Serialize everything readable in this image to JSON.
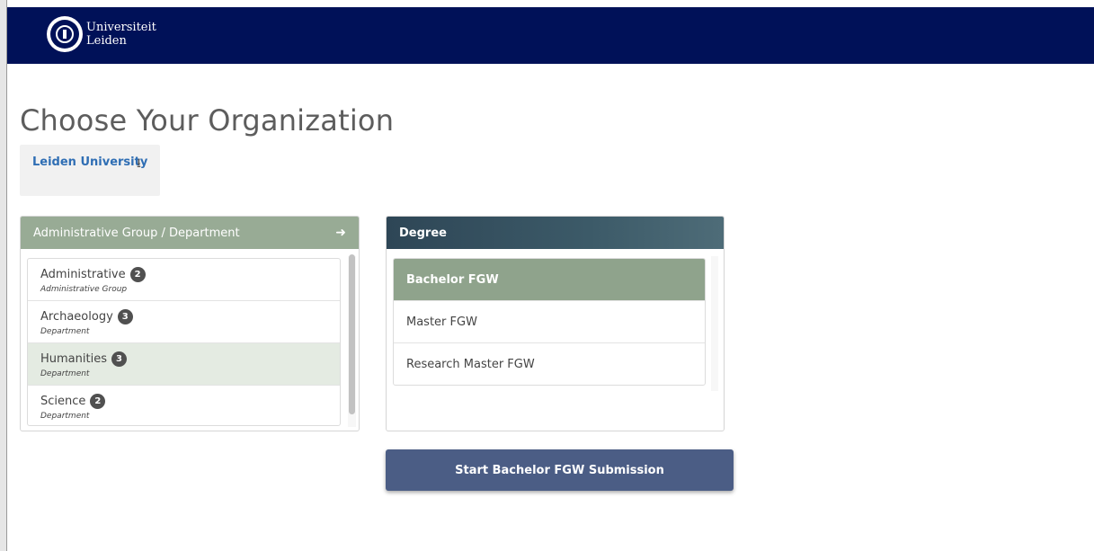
{
  "header": {
    "logo_line1": "Universiteit",
    "logo_line2": "Leiden",
    "background": "#001158"
  },
  "page_title": "Choose Your Organization",
  "org_selector": {
    "label": "Leiden University",
    "icon": "arrow-down-icon",
    "icon_glyph": "⭳"
  },
  "admin_panel": {
    "header": "Administrative Group / Department",
    "header_icon": "arrow-right-icon",
    "header_glyph": "➜",
    "items": [
      {
        "title": "Administrative",
        "count": "2",
        "subtitle": "Administrative Group",
        "selected": false
      },
      {
        "title": "Archaeology",
        "count": "3",
        "subtitle": "Department",
        "selected": false
      },
      {
        "title": "Humanities",
        "count": "3",
        "subtitle": "Department",
        "selected": true
      },
      {
        "title": "Science",
        "count": "2",
        "subtitle": "Department",
        "selected": false
      }
    ]
  },
  "degree_panel": {
    "header": "Degree",
    "items": [
      {
        "label": "Bachelor FGW",
        "selected": true
      },
      {
        "label": "Master FGW",
        "selected": false
      },
      {
        "label": "Research Master FGW",
        "selected": false
      }
    ]
  },
  "start_button": {
    "label": "Start Bachelor FGW Submission"
  },
  "colors": {
    "accent_green": "#98ab95",
    "selected_green": "#8fa38c",
    "button_blue": "#4b5d85",
    "link_blue": "#2f6eb4"
  }
}
